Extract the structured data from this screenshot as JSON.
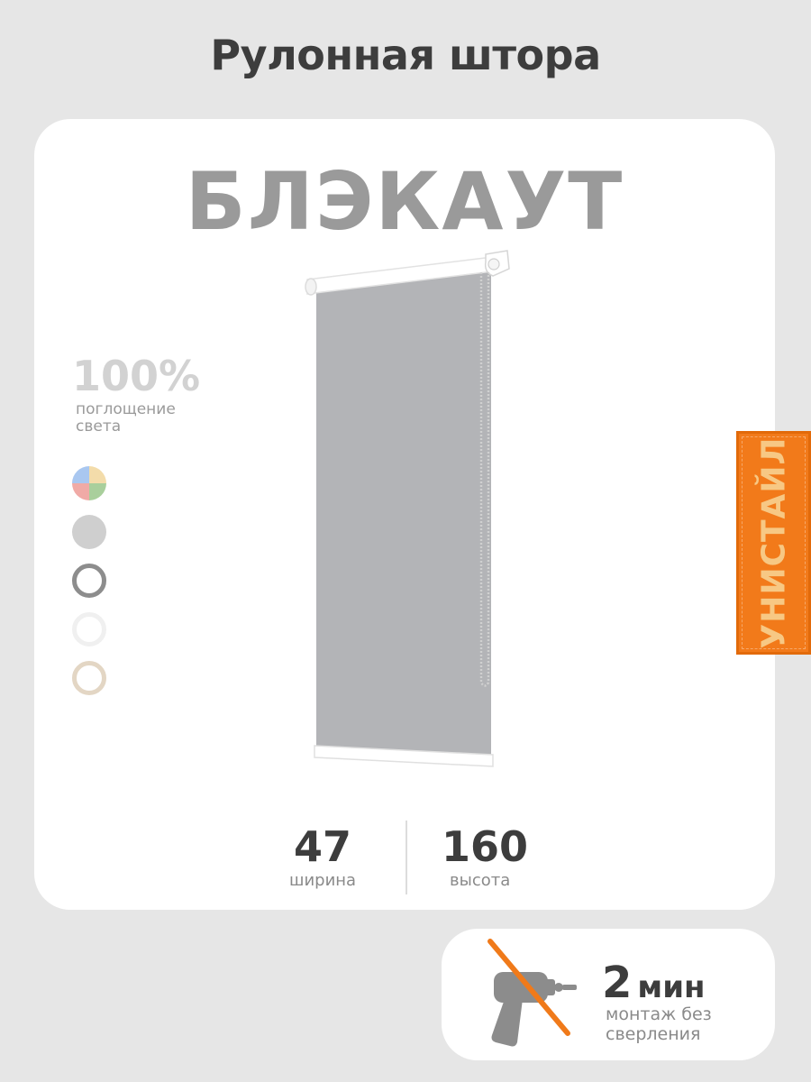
{
  "header": {
    "title": "Рулонная штора"
  },
  "product": {
    "name": "БЛЭКАУТ",
    "absorption_value": "100%",
    "absorption_label": "поглощение света",
    "colors": [
      {
        "name": "multicolor",
        "colors": [
          "#a9c7f0",
          "#f3dcaa",
          "#f0aaa6",
          "#a9cf9c"
        ]
      },
      {
        "name": "gray",
        "color": "#cfcfcf"
      },
      {
        "name": "graphite",
        "color": "#8d8d8d"
      },
      {
        "name": "white",
        "color": "#f0f0f0"
      },
      {
        "name": "beige",
        "color": "#e3d6c4"
      }
    ],
    "fabric_color": "#b3b4b7"
  },
  "dimensions": {
    "width_value": "47",
    "width_label": "ширина",
    "height_value": "160",
    "height_label": "высота"
  },
  "brand": {
    "name": "УНИСТАЙЛ",
    "color": "#f27a1a",
    "text_color": "#f7c884"
  },
  "install": {
    "time_value": "2",
    "time_unit": "мин",
    "note": "монтаж без сверления",
    "icon": "no-drill-icon",
    "accent_color": "#f07a1a"
  }
}
